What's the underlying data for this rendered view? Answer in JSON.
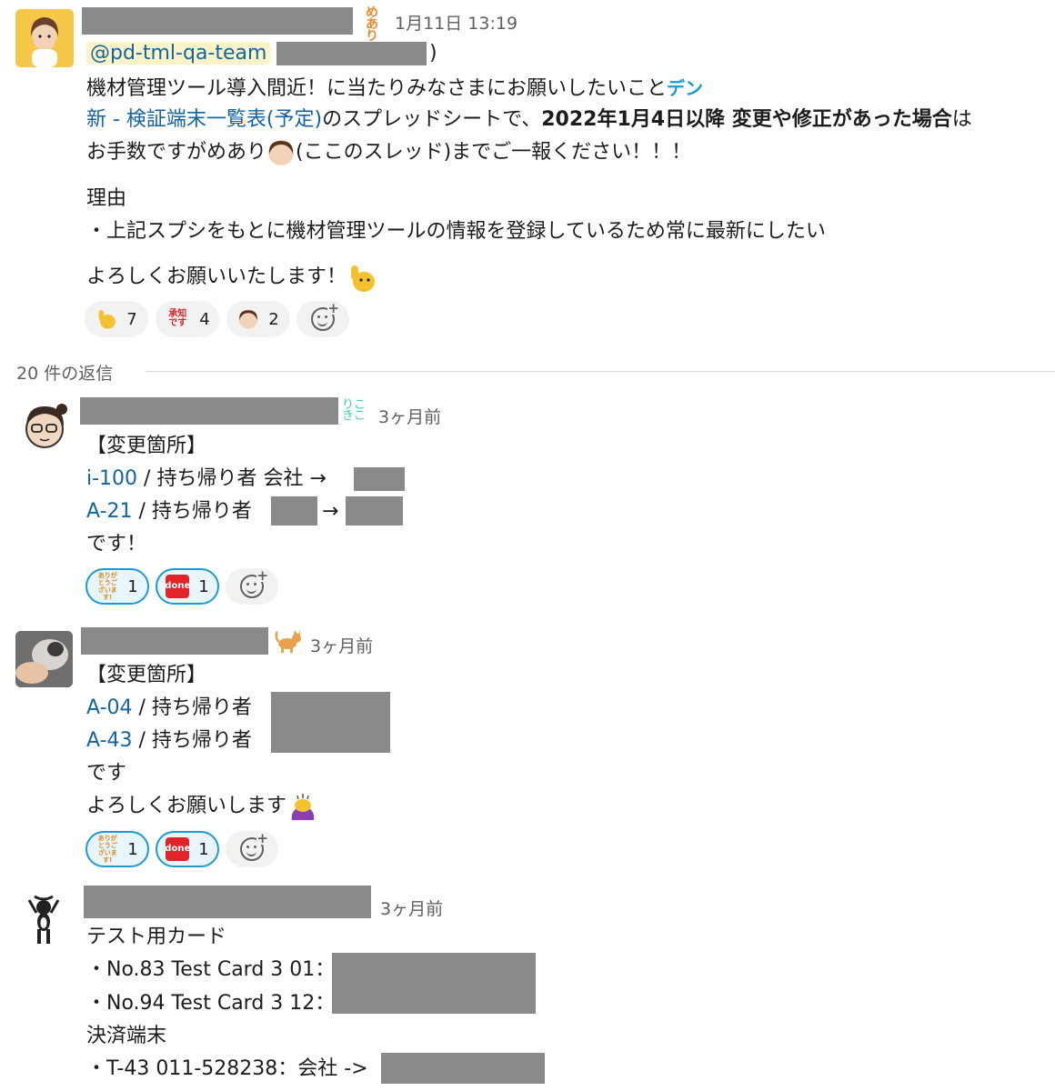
{
  "parent_message": {
    "timestamp": "1月11日 13:19",
    "status_tag": "めあり",
    "mention": "@pd-tml-qa-team",
    "paren_open": "(",
    "paren_close": ")",
    "line1": "機材管理ツール導入間近！に当たりみなさまにお願いしたいこと",
    "line1_emoji": "デン",
    "line2_link": "新 - 検証端末一覧表(予定)",
    "line2_text": "のスプレッドシートで、",
    "line2_bold": "2022年1月4日以降 変更や修正があった場合",
    "line2_end": "は",
    "line3_a": "お手数ですがめあり",
    "line3_b": "(ここのスレッド)までご一報ください！！！",
    "reason_title": "理由",
    "reason_line": "・上記スプシをもとに機材管理ツールの情報を登録しているため常に最新にしたい",
    "closing": "よろしくお願いいたします！",
    "reactions": [
      {
        "icon": "raised-hand-emoji",
        "count": "7"
      },
      {
        "icon": "shouchi-desu-emoji",
        "label": "承知です",
        "count": "4"
      },
      {
        "icon": "person-face-emoji",
        "count": "2"
      }
    ]
  },
  "thread": {
    "reply_count": "20 件の返信"
  },
  "replies": [
    {
      "time": "3ヶ月前",
      "status_tag": "りこきこ",
      "lines": {
        "header": "【変更箇所】",
        "item1_link": "i-100",
        "item1_text": " / 持ち帰り者 会社 →",
        "item2_link": "A-21",
        "item2_text": " / 持ち帰り者",
        "item2_arrow": "→",
        "end": "です！"
      },
      "reactions": [
        {
          "icon": "arigatou-emoji",
          "label": "ありがとうございます!",
          "count": "1"
        },
        {
          "icon": "done-emoji",
          "label": "done",
          "count": "1"
        }
      ]
    },
    {
      "time": "3ヶ月前",
      "status_tag": "cat",
      "lines": {
        "header": "【変更箇所】",
        "item1_link": "A-04",
        "item1_text": " / 持ち帰り者",
        "item2_link": "A-43",
        "item2_text": " / 持ち帰り者",
        "end": "です",
        "closing": "よろしくお願いします"
      },
      "reactions": [
        {
          "icon": "arigatou-emoji",
          "label": "ありがとうございます!",
          "count": "1"
        },
        {
          "icon": "done-emoji",
          "label": "done",
          "count": "1"
        }
      ]
    },
    {
      "time": "3ヶ月前",
      "lines": {
        "title1": "テスト用カード",
        "card1": "・No.83 Test Card 3 01：",
        "card2": "・No.94 Test Card 3 12：",
        "title2": "決済端末",
        "terminal": "・T-43 011-528238：会社 ->"
      }
    }
  ],
  "colors": {
    "link": "#1264a3",
    "mention_bg": "#fcf3c6",
    "selected_reaction_border": "#1d9bd1",
    "redaction": "#8a8a8a"
  }
}
